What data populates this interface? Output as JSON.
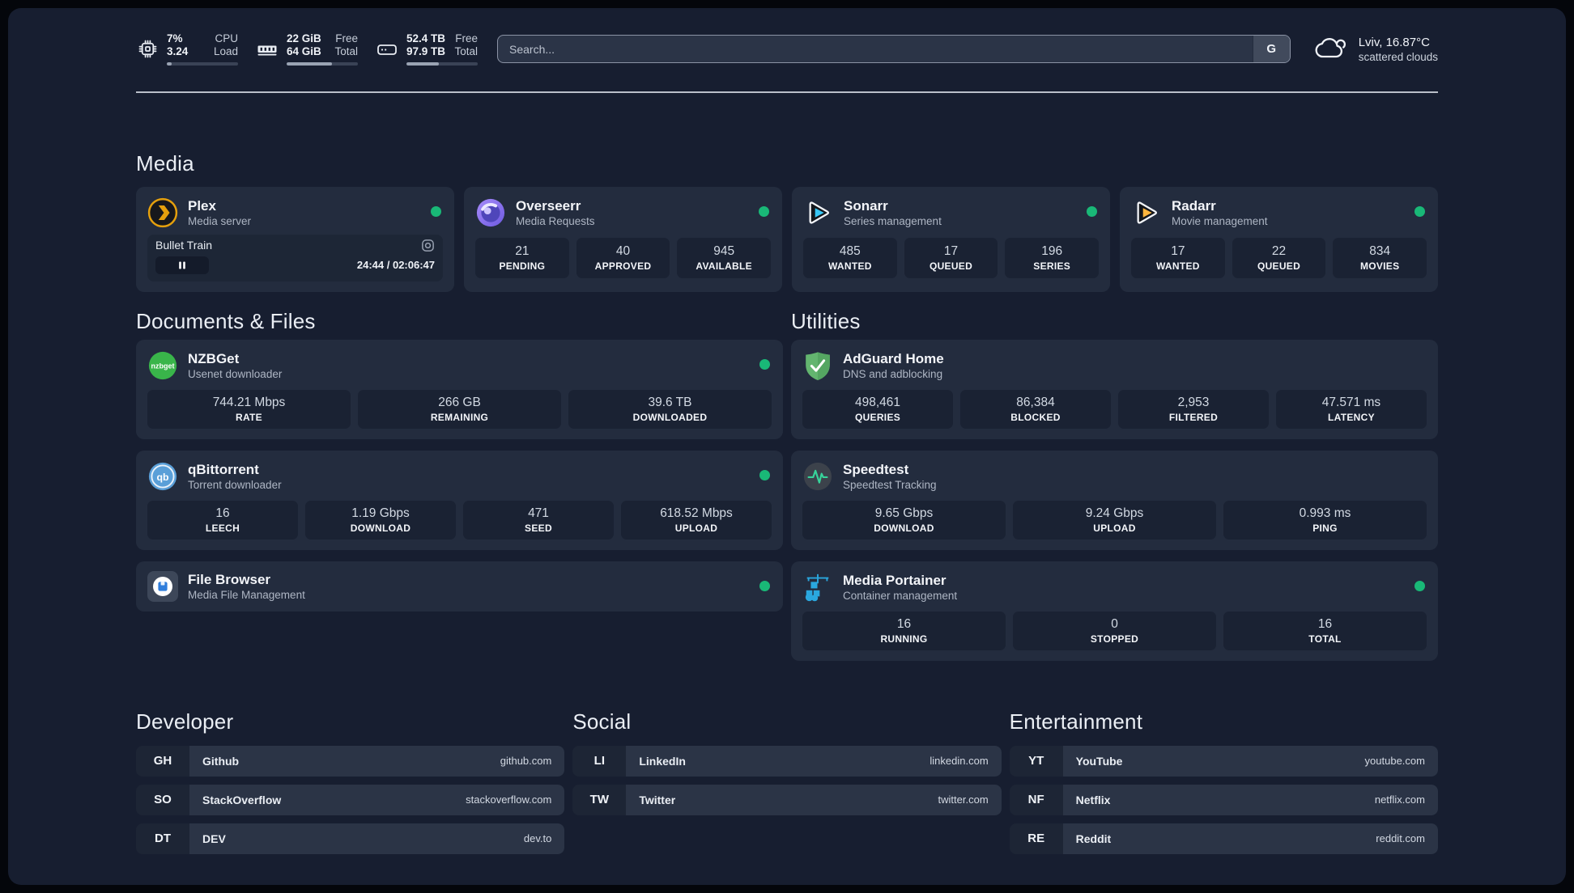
{
  "header": {
    "stats": [
      {
        "name": "cpu",
        "line1_value": "7%",
        "line1_label": "CPU",
        "line2_value": "3.24",
        "line2_label": "Load",
        "progress_pct": 7
      },
      {
        "name": "memory",
        "line1_value": "22 GiB",
        "line1_label": "Free",
        "line2_value": "64 GiB",
        "line2_label": "Total",
        "progress_pct": 64
      },
      {
        "name": "storage",
        "line1_value": "52.4 TB",
        "line1_label": "Free",
        "line2_value": "97.9 TB",
        "line2_label": "Total",
        "progress_pct": 46
      }
    ],
    "search_placeholder": "Search...",
    "search_button_label": "G",
    "weather_location": "Lviv, 16.87°C",
    "weather_condition": "scattered clouds"
  },
  "media": {
    "heading": "Media",
    "plex": {
      "title": "Plex",
      "subtitle": "Media server",
      "now_playing": "Bullet Train",
      "time": "24:44 / 02:06:47"
    },
    "overseerr": {
      "title": "Overseerr",
      "subtitle": "Media Requests",
      "stats": [
        {
          "value": "21",
          "label": "PENDING"
        },
        {
          "value": "40",
          "label": "APPROVED"
        },
        {
          "value": "945",
          "label": "AVAILABLE"
        }
      ]
    },
    "sonarr": {
      "title": "Sonarr",
      "subtitle": "Series management",
      "stats": [
        {
          "value": "485",
          "label": "WANTED"
        },
        {
          "value": "17",
          "label": "QUEUED"
        },
        {
          "value": "196",
          "label": "SERIES"
        }
      ]
    },
    "radarr": {
      "title": "Radarr",
      "subtitle": "Movie management",
      "stats": [
        {
          "value": "17",
          "label": "WANTED"
        },
        {
          "value": "22",
          "label": "QUEUED"
        },
        {
          "value": "834",
          "label": "MOVIES"
        }
      ]
    }
  },
  "documents": {
    "heading": "Documents & Files",
    "nzbget": {
      "title": "NZBGet",
      "subtitle": "Usenet downloader",
      "stats": [
        {
          "value": "744.21 Mbps",
          "label": "RATE"
        },
        {
          "value": "266 GB",
          "label": "REMAINING"
        },
        {
          "value": "39.6 TB",
          "label": "DOWNLOADED"
        }
      ]
    },
    "qbittorrent": {
      "title": "qBittorrent",
      "subtitle": "Torrent downloader",
      "stats": [
        {
          "value": "16",
          "label": "LEECH"
        },
        {
          "value": "1.19 Gbps",
          "label": "DOWNLOAD"
        },
        {
          "value": "471",
          "label": "SEED"
        },
        {
          "value": "618.52 Mbps",
          "label": "UPLOAD"
        }
      ]
    },
    "filebrowser": {
      "title": "File Browser",
      "subtitle": "Media File Management"
    }
  },
  "utilities": {
    "heading": "Utilities",
    "adguard": {
      "title": "AdGuard Home",
      "subtitle": "DNS and adblocking",
      "stats": [
        {
          "value": "498,461",
          "label": "QUERIES"
        },
        {
          "value": "86,384",
          "label": "BLOCKED"
        },
        {
          "value": "2,953",
          "label": "FILTERED"
        },
        {
          "value": "47.571 ms",
          "label": "LATENCY"
        }
      ]
    },
    "speedtest": {
      "title": "Speedtest",
      "subtitle": "Speedtest Tracking",
      "stats": [
        {
          "value": "9.65 Gbps",
          "label": "DOWNLOAD"
        },
        {
          "value": "9.24 Gbps",
          "label": "UPLOAD"
        },
        {
          "value": "0.993 ms",
          "label": "PING"
        }
      ]
    },
    "portainer": {
      "title": "Media Portainer",
      "subtitle": "Container management",
      "stats": [
        {
          "value": "16",
          "label": "RUNNING"
        },
        {
          "value": "0",
          "label": "STOPPED"
        },
        {
          "value": "16",
          "label": "TOTAL"
        }
      ]
    }
  },
  "bookmarks": {
    "developer": {
      "heading": "Developer",
      "links": [
        {
          "abbr": "GH",
          "name": "Github",
          "url": "github.com"
        },
        {
          "abbr": "SO",
          "name": "StackOverflow",
          "url": "stackoverflow.com"
        },
        {
          "abbr": "DT",
          "name": "DEV",
          "url": "dev.to"
        }
      ]
    },
    "social": {
      "heading": "Social",
      "links": [
        {
          "abbr": "LI",
          "name": "LinkedIn",
          "url": "linkedin.com"
        },
        {
          "abbr": "TW",
          "name": "Twitter",
          "url": "twitter.com"
        }
      ]
    },
    "entertainment": {
      "heading": "Entertainment",
      "links": [
        {
          "abbr": "YT",
          "name": "YouTube",
          "url": "youtube.com"
        },
        {
          "abbr": "NF",
          "name": "Netflix",
          "url": "netflix.com"
        },
        {
          "abbr": "RE",
          "name": "Reddit",
          "url": "reddit.com"
        }
      ]
    }
  },
  "colors": {
    "status_online": "#19b877",
    "accent": "#2aa7de"
  }
}
